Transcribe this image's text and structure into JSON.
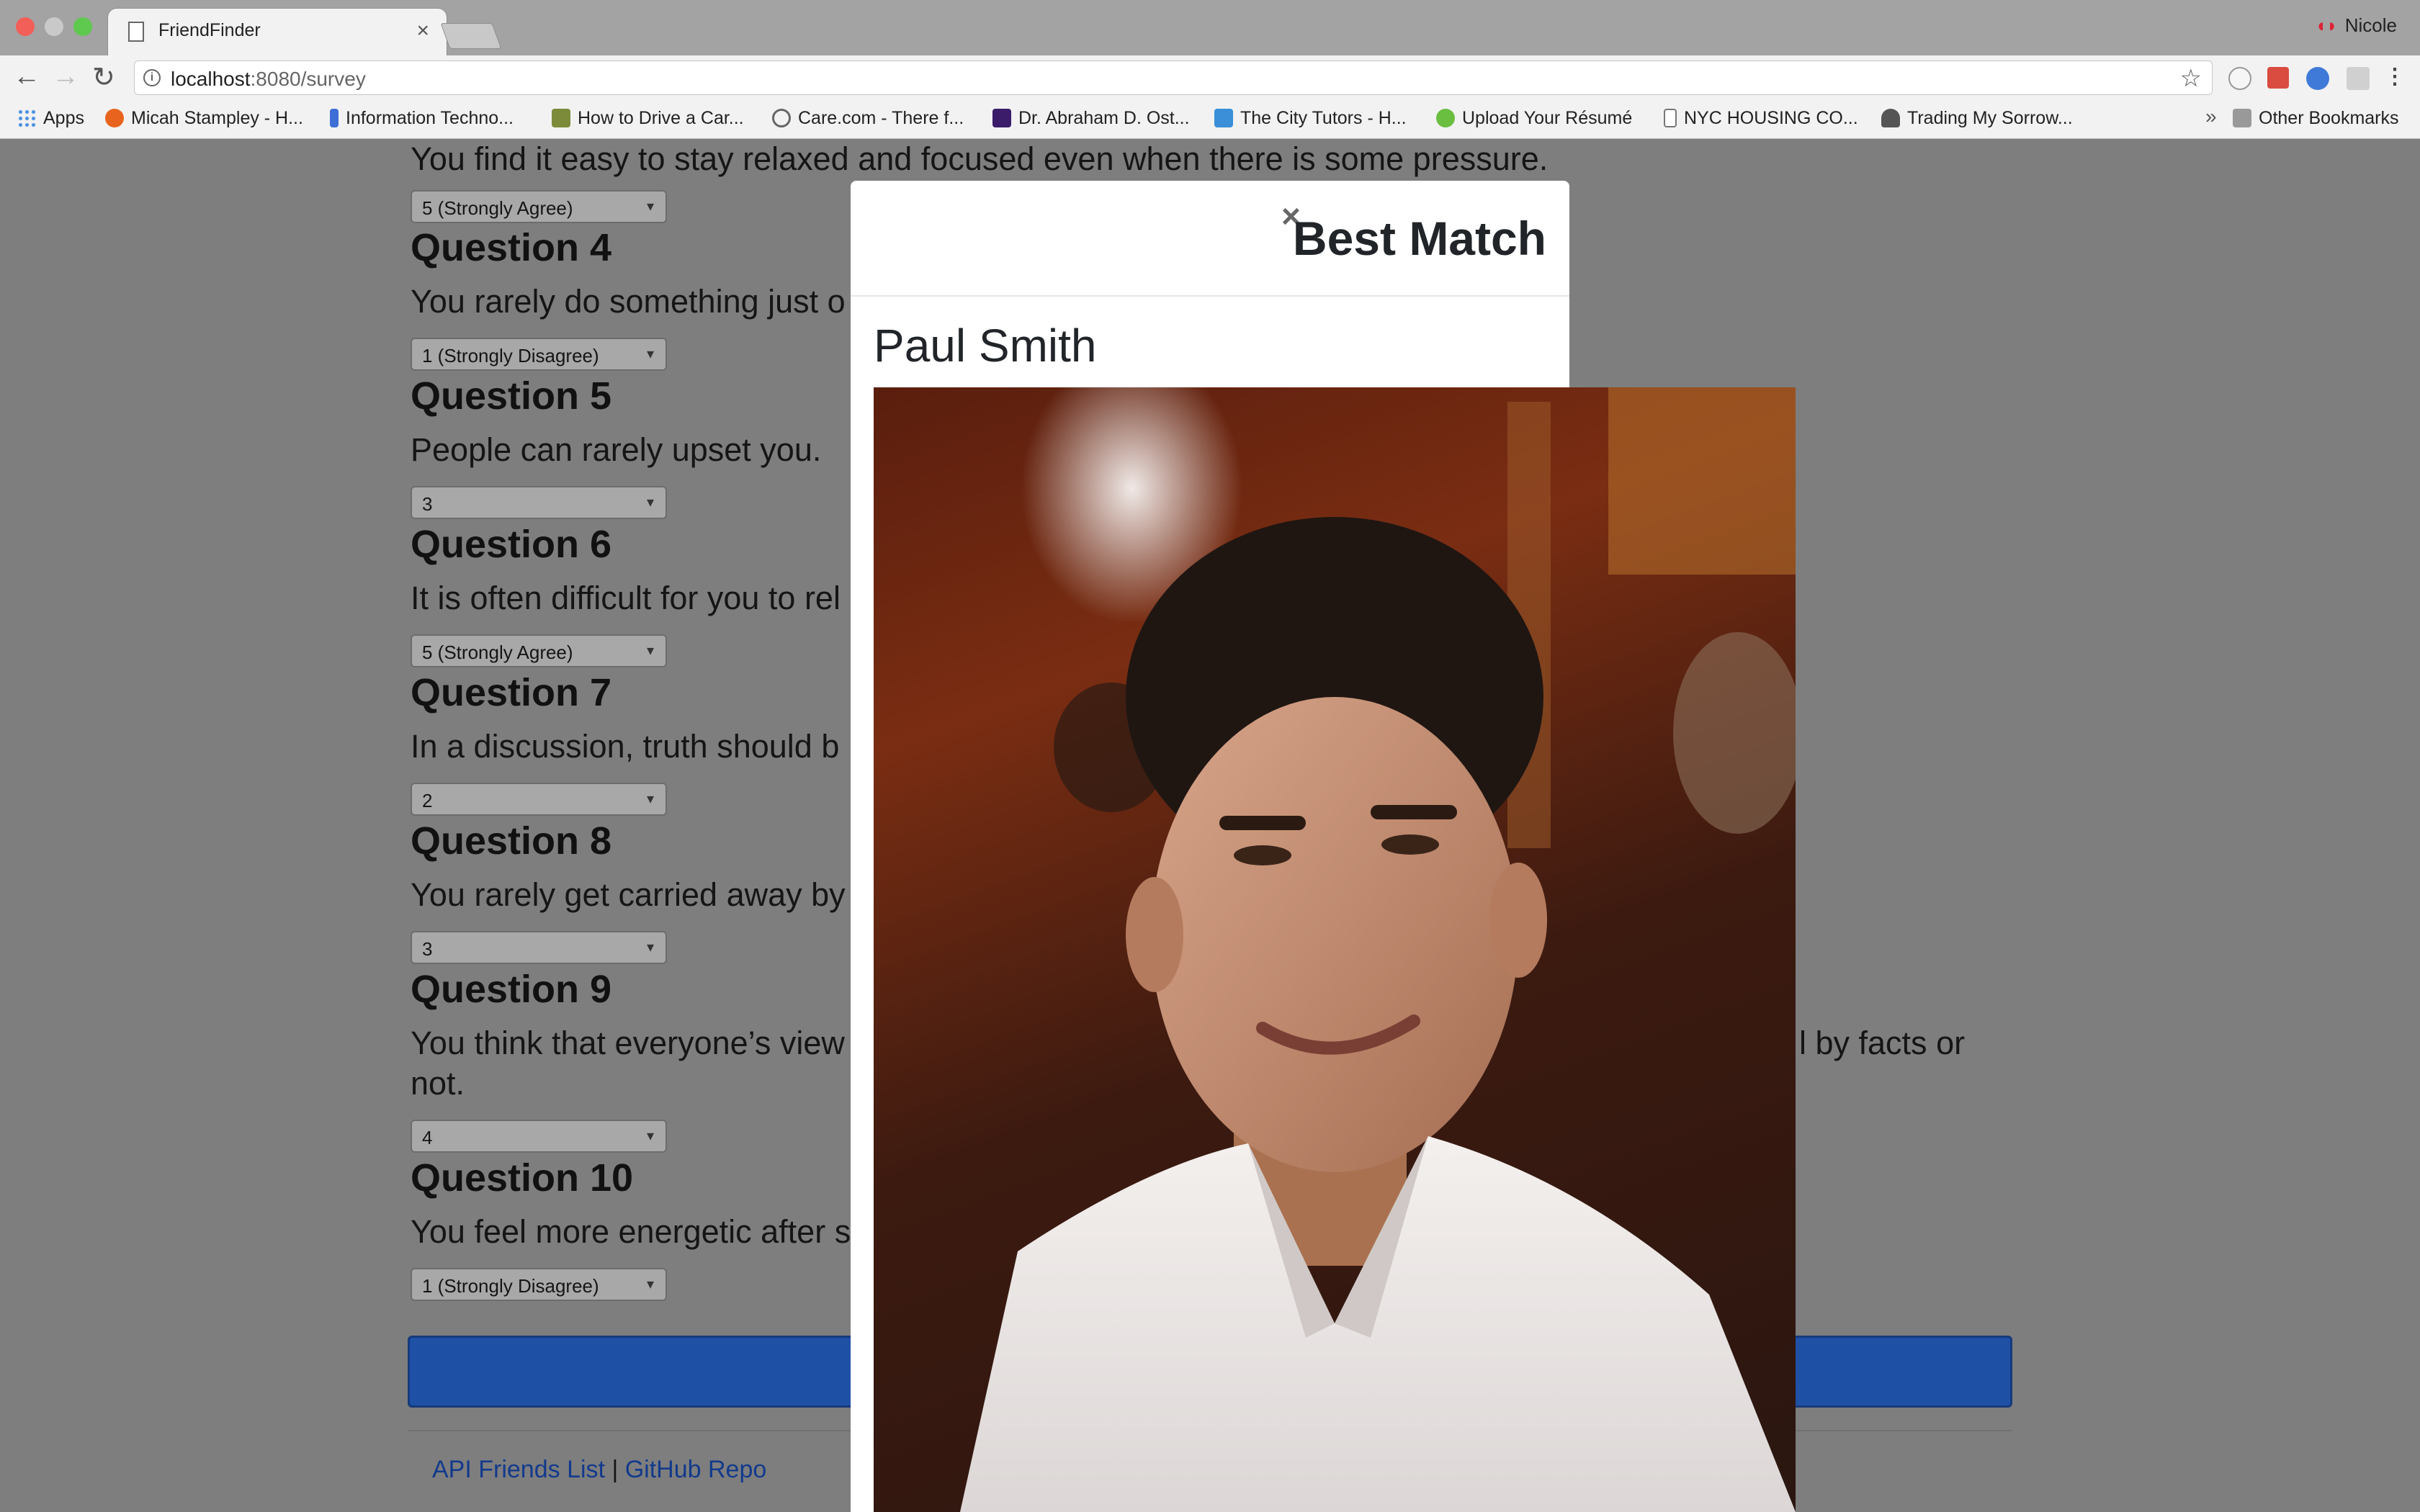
{
  "browser": {
    "tab_title": "FriendFinder",
    "tab_close": "×",
    "profile_name": "Nicole",
    "url_host": "localhost",
    "url_rest": ":8080/survey",
    "bookmarks": [
      {
        "label": "Apps"
      },
      {
        "label": "Micah Stampley - H..."
      },
      {
        "label": "Information Techno..."
      },
      {
        "label": "How to Drive a Car..."
      },
      {
        "label": "Care.com - There f..."
      },
      {
        "label": "Dr. Abraham D. Ost..."
      },
      {
        "label": "The City Tutors - H..."
      },
      {
        "label": "Upload Your Résumé"
      },
      {
        "label": "NYC HOUSING CO..."
      },
      {
        "label": "Trading My Sorrow..."
      }
    ],
    "bookmarks_overflow": "»",
    "other_bookmarks": "Other Bookmarks"
  },
  "survey": {
    "top_question_text": "You find it easy to stay relaxed and focused even when there is some pressure.",
    "top_question_answer": "5 (Strongly Agree)",
    "questions": [
      {
        "heading": "Question 4",
        "text": "You rarely do something just o",
        "answer": "1 (Strongly Disagree)"
      },
      {
        "heading": "Question 5",
        "text": "People can rarely upset you.",
        "answer": "3"
      },
      {
        "heading": "Question 6",
        "text": "It is often difficult for you to rel",
        "answer": "5 (Strongly Agree)"
      },
      {
        "heading": "Question 7",
        "text": "In a discussion, truth should b",
        "answer": "2"
      },
      {
        "heading": "Question 8",
        "text": "You rarely get carried away by",
        "answer": "3"
      },
      {
        "heading": "Question 9",
        "text": "You think that everyone’s view",
        "text_tail": "l by facts or",
        "text_line2": "not.",
        "answer": "4"
      },
      {
        "heading": "Question 10",
        "text": "You feel more energetic after s",
        "answer": "1 (Strongly Disagree)"
      }
    ]
  },
  "footer": {
    "api_link": "API Friends List",
    "separator": "|",
    "github_link": "GitHub Repo"
  },
  "modal": {
    "close": "×",
    "title": "Best Match",
    "name": "Paul Smith"
  }
}
